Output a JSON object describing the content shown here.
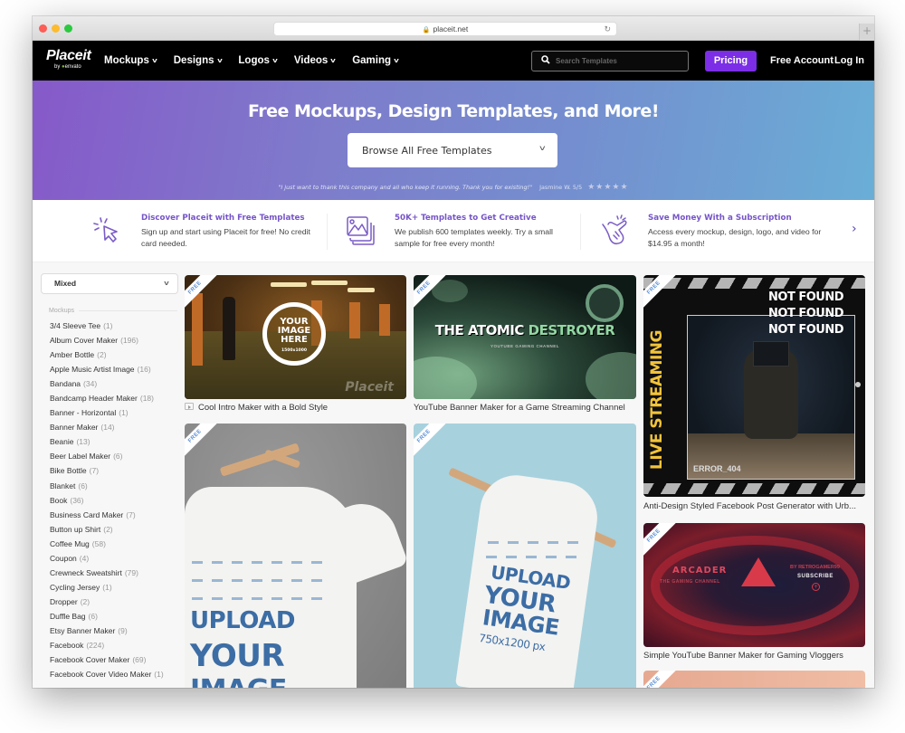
{
  "browser": {
    "url": "placeit.net",
    "new_tab_label": "+"
  },
  "nav": {
    "logo_main": "Placeit",
    "logo_sub_prefix": "by ",
    "logo_sub_brand": "envato",
    "items": [
      {
        "label": "Mockups"
      },
      {
        "label": "Designs"
      },
      {
        "label": "Logos"
      },
      {
        "label": "Videos"
      },
      {
        "label": "Gaming"
      }
    ],
    "chevron_glyph": "v",
    "search_placeholder": "Search Templates",
    "search_icon": "search-icon",
    "pricing_label": "Pricing",
    "free_account_label": "Free Account",
    "login_label": "Log In",
    "pricing_color": "#7b2ee6"
  },
  "hero": {
    "title": "Free Mockups, Design Templates, and More!",
    "browse_label": "Browse All Free Templates",
    "testimonial_quote": "\"I just want to thank this company and all who keep it running. Thank you for existing!\"",
    "testimonial_author": "Jasmine W. 5/5",
    "rating": 5,
    "rating_max": 5,
    "stars": "★★★★★"
  },
  "features": [
    {
      "icon": "cursor-click-icon",
      "title": "Discover Placeit with Free Templates",
      "description": "Sign up and start using Placeit for free! No credit card needed."
    },
    {
      "icon": "image-stack-icon",
      "title": "50K+ Templates to Get Creative",
      "description": "We publish 600 templates weekly. Try a small sample for free every month!"
    },
    {
      "icon": "snap-fingers-icon",
      "title": "Save Money With a Subscription",
      "description": "Access every mockup, design, logo, and video for $14.95 a month!"
    }
  ],
  "features_next_glyph": "›",
  "sidebar": {
    "filter_value": "Mixed",
    "section_heading": "Mockups",
    "categories": [
      {
        "name": "3/4 Sleeve Tee",
        "count": "(1)"
      },
      {
        "name": "Album Cover Maker",
        "count": "(196)"
      },
      {
        "name": "Amber Bottle",
        "count": "(2)"
      },
      {
        "name": "Apple Music Artist Image",
        "count": "(16)"
      },
      {
        "name": "Bandana",
        "count": "(34)"
      },
      {
        "name": "Bandcamp Header Maker",
        "count": "(18)"
      },
      {
        "name": "Banner - Horizontal",
        "count": "(1)"
      },
      {
        "name": "Banner Maker",
        "count": "(14)"
      },
      {
        "name": "Beanie",
        "count": "(13)"
      },
      {
        "name": "Beer Label Maker",
        "count": "(6)"
      },
      {
        "name": "Bike Bottle",
        "count": "(7)"
      },
      {
        "name": "Blanket",
        "count": "(6)"
      },
      {
        "name": "Book",
        "count": "(36)"
      },
      {
        "name": "Business Card Maker",
        "count": "(7)"
      },
      {
        "name": "Button up Shirt",
        "count": "(2)"
      },
      {
        "name": "Coffee Mug",
        "count": "(58)"
      },
      {
        "name": "Coupon",
        "count": "(4)"
      },
      {
        "name": "Crewneck Sweatshirt",
        "count": "(79)"
      },
      {
        "name": "Cycling Jersey",
        "count": "(1)"
      },
      {
        "name": "Dropper",
        "count": "(2)"
      },
      {
        "name": "Duffle Bag",
        "count": "(6)"
      },
      {
        "name": "Etsy Banner Maker",
        "count": "(9)"
      },
      {
        "name": "Facebook",
        "count": "(224)"
      },
      {
        "name": "Facebook Cover Maker",
        "count": "(69)"
      },
      {
        "name": "Facebook Cover Video Maker",
        "count": "(1)"
      }
    ]
  },
  "badge_label": "FREE",
  "templates": [
    {
      "title": "Cool Intro Maker with a Bold Style",
      "type": "video",
      "art": {
        "circle_line1": "YOUR",
        "circle_line2": "IMAGE",
        "circle_line3": "HERE",
        "circle_size": "1500x1000",
        "watermark": "Placeit"
      }
    },
    {
      "title": "YouTube Banner Maker for a Game Streaming Channel",
      "type": "image",
      "art": {
        "title_a": "THE ATOMIC ",
        "title_b": "DESTROYER",
        "subtitle": "YOUTUBE GAMING CHANNEL"
      }
    },
    {
      "title": "Anti-Design Styled Facebook Post Generator with Urb...",
      "type": "image",
      "art": {
        "nf1": "NOT FOUND",
        "nf2": "NOT FOUND",
        "nf3": "NOT FOUND",
        "vertical": "LIVE STREAMING",
        "error": "ERROR_404"
      }
    },
    {
      "title": "",
      "type": "image",
      "art": {
        "line1": "UPLOAD",
        "line2": "YOUR",
        "line3": "IMAGE"
      }
    },
    {
      "title": "",
      "type": "image",
      "art": {
        "line1": "UPLOAD",
        "line2": "YOUR",
        "line3": "IMAGE",
        "size": "750x1200 px"
      }
    },
    {
      "title": "Simple YouTube Banner Maker for Gaming Vloggers",
      "type": "image",
      "art": {
        "name": "ARCADER",
        "tagline": "THE GAMING CHANNEL",
        "by": "BY RETROGAMER99",
        "subscribe": "SUBSCRIBE"
      }
    },
    {
      "title": "",
      "type": "image",
      "art": {}
    }
  ]
}
